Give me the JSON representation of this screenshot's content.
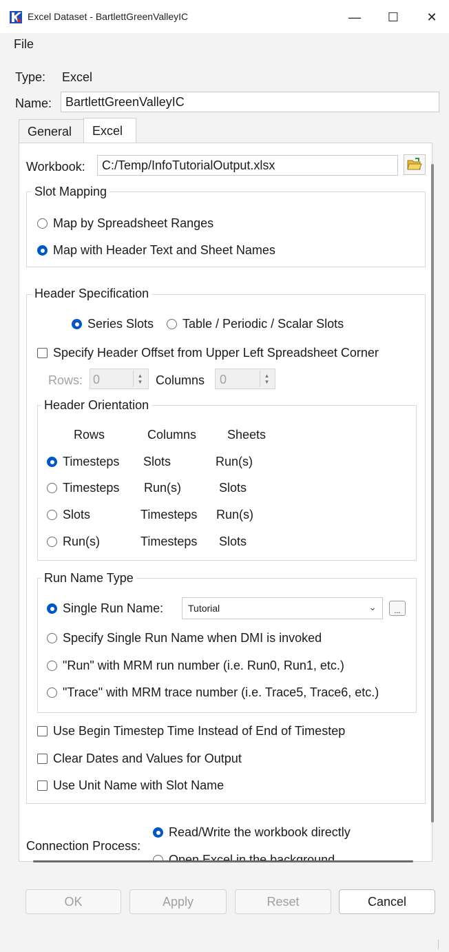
{
  "window": {
    "title": "Excel Dataset - BartlettGreenValleyIC",
    "controls": {
      "minimize": "—",
      "maximize": "☐",
      "close": "✕"
    },
    "accent": "#0058c8"
  },
  "menu": {
    "file": "File"
  },
  "type_row": {
    "label": "Type:",
    "value": "Excel"
  },
  "name_row": {
    "label": "Name:",
    "value": "BartlettGreenValleyIC"
  },
  "tabs": [
    {
      "label": "General",
      "selected": false
    },
    {
      "label": "Excel",
      "selected": true
    }
  ],
  "workbook": {
    "label": "Workbook:",
    "value": "C:/Temp/InfoTutorialOutput.xlsx",
    "browse_icon": "folder-open-icon"
  },
  "slot_mapping": {
    "title": "Slot Mapping",
    "options": [
      {
        "label": "Map by Spreadsheet Ranges",
        "selected": false
      },
      {
        "label": "Map with Header Text and Sheet Names",
        "selected": true
      }
    ]
  },
  "header_spec": {
    "title": "Header Specification",
    "slot_type": [
      {
        "label": "Series Slots",
        "selected": true
      },
      {
        "label": "Table / Periodic / Scalar Slots",
        "selected": false
      }
    ],
    "offset_checkbox": {
      "label": "Specify Header Offset from Upper Left Spreadsheet Corner",
      "checked": false
    },
    "rows_label": "Rows:",
    "rows_value": "0",
    "columns_label": "Columns",
    "columns_value": "0",
    "orientation": {
      "title": "Header Orientation",
      "headers": [
        "Rows",
        "Columns",
        "Sheets"
      ],
      "options": [
        {
          "rows": "Timesteps",
          "columns": "Slots",
          "sheets": "Run(s)",
          "selected": true
        },
        {
          "rows": "Timesteps",
          "columns": "Run(s)",
          "sheets": "Slots",
          "selected": false
        },
        {
          "rows": "Slots",
          "columns": "Timesteps",
          "sheets": "Run(s)",
          "selected": false
        },
        {
          "rows": "Run(s)",
          "columns": "Timesteps",
          "sheets": "Slots",
          "selected": false
        }
      ]
    },
    "run_name_type": {
      "title": "Run Name Type",
      "single_label": "Single Run Name:",
      "single_value": "Tutorial",
      "ellipsis": "...",
      "options": [
        {
          "label": "Single Run Name:",
          "selected": true
        },
        {
          "label": "Specify Single Run Name when DMI is invoked",
          "selected": false
        },
        {
          "label": "\"Run\" with MRM run number (i.e. Run0, Run1, etc.)",
          "selected": false
        },
        {
          "label": "\"Trace\" with MRM trace number (i.e. Trace5, Trace6, etc.)",
          "selected": false
        }
      ]
    },
    "checkboxes": [
      {
        "label": "Use Begin Timestep Time Instead of End of Timestep",
        "checked": false
      },
      {
        "label": "Clear Dates and Values for Output",
        "checked": false
      },
      {
        "label": "Use Unit Name with Slot Name",
        "checked": false
      }
    ]
  },
  "connection": {
    "label": "Connection Process:",
    "options": [
      {
        "label": "Read/Write the workbook directly",
        "selected": true
      },
      {
        "label": "Open Excel in the background",
        "selected": false
      }
    ]
  },
  "buttons": {
    "ok": "OK",
    "apply": "Apply",
    "reset": "Reset",
    "cancel": "Cancel"
  }
}
